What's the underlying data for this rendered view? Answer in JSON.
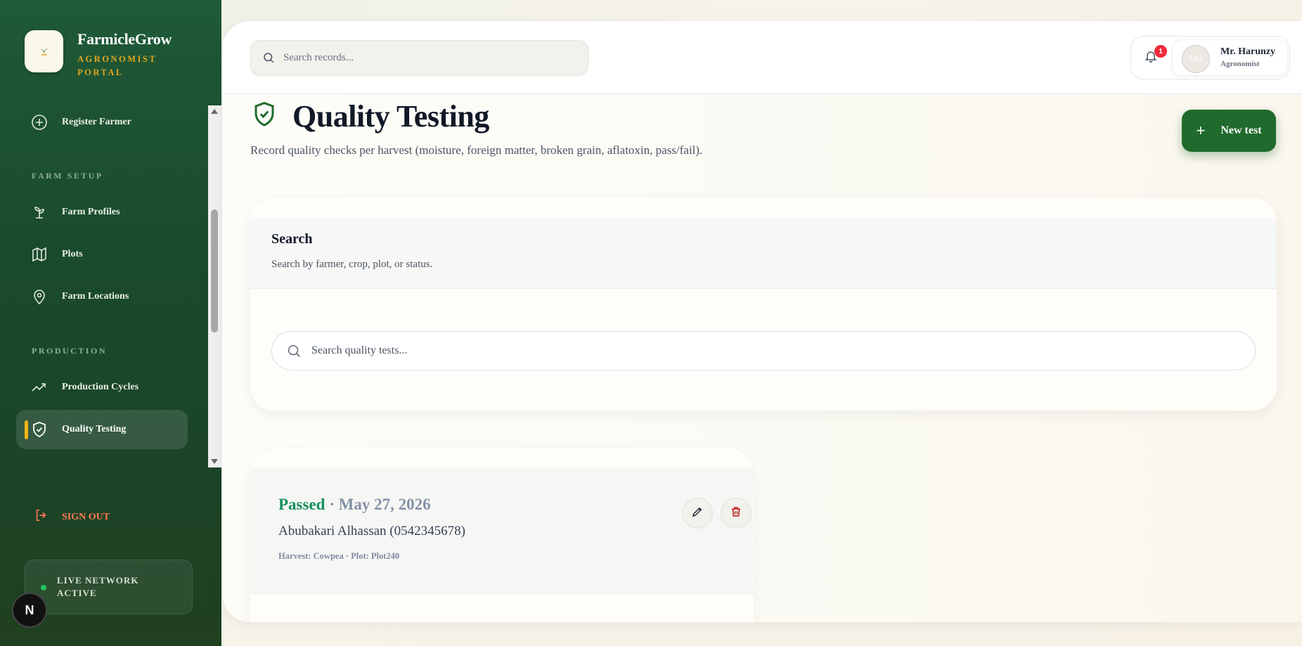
{
  "brand": {
    "title": "FarmicleGrow",
    "subtitle_line1": "AGRONOMIST",
    "subtitle_line2": "PORTAL"
  },
  "sidebar": {
    "items": [
      {
        "label": "Register Farmer",
        "icon": "plus-circle-icon"
      },
      {
        "label": "Farm Profiles",
        "icon": "sprout-icon"
      },
      {
        "label": "Plots",
        "icon": "map-icon"
      },
      {
        "label": "Farm Locations",
        "icon": "map-pin-icon"
      },
      {
        "label": "Production Cycles",
        "icon": "trending-up-icon"
      },
      {
        "label": "Quality Testing",
        "icon": "shield-check-icon",
        "active": true
      }
    ],
    "sections": {
      "farm_setup": "FARM SETUP",
      "production": "PRODUCTION"
    },
    "sign_out": "SIGN OUT",
    "network_line1": "LIVE NETWORK",
    "network_line2": "ACTIVE",
    "n_badge": "N"
  },
  "topbar": {
    "search_placeholder": "Search records...",
    "notification_count": "1",
    "user_initials": "MH",
    "user_name": "Mr. Harunzy",
    "user_role": "Agronomist"
  },
  "page": {
    "title": "Quality Testing",
    "subtitle": "Record quality checks per harvest (moisture, foreign matter, broken grain, aflatoxin, pass/fail).",
    "new_button": "New test"
  },
  "search_card": {
    "title": "Search",
    "description": "Search by farmer, crop, plot, or status.",
    "placeholder": "Search quality tests..."
  },
  "records": [
    {
      "status": "Passed",
      "separator": " · ",
      "date": "May 27, 2026",
      "farmer": "Abubakari Alhassan (0542345678)",
      "meta": "Harvest: Cowpea · Plot: Plot240"
    }
  ],
  "colors": {
    "accent_green": "#1f6a2c",
    "passed_green": "#15905a",
    "brand_gold": "#e0a51f",
    "signout_red": "#ff7a55",
    "badge_red": "#ef2b3a"
  }
}
